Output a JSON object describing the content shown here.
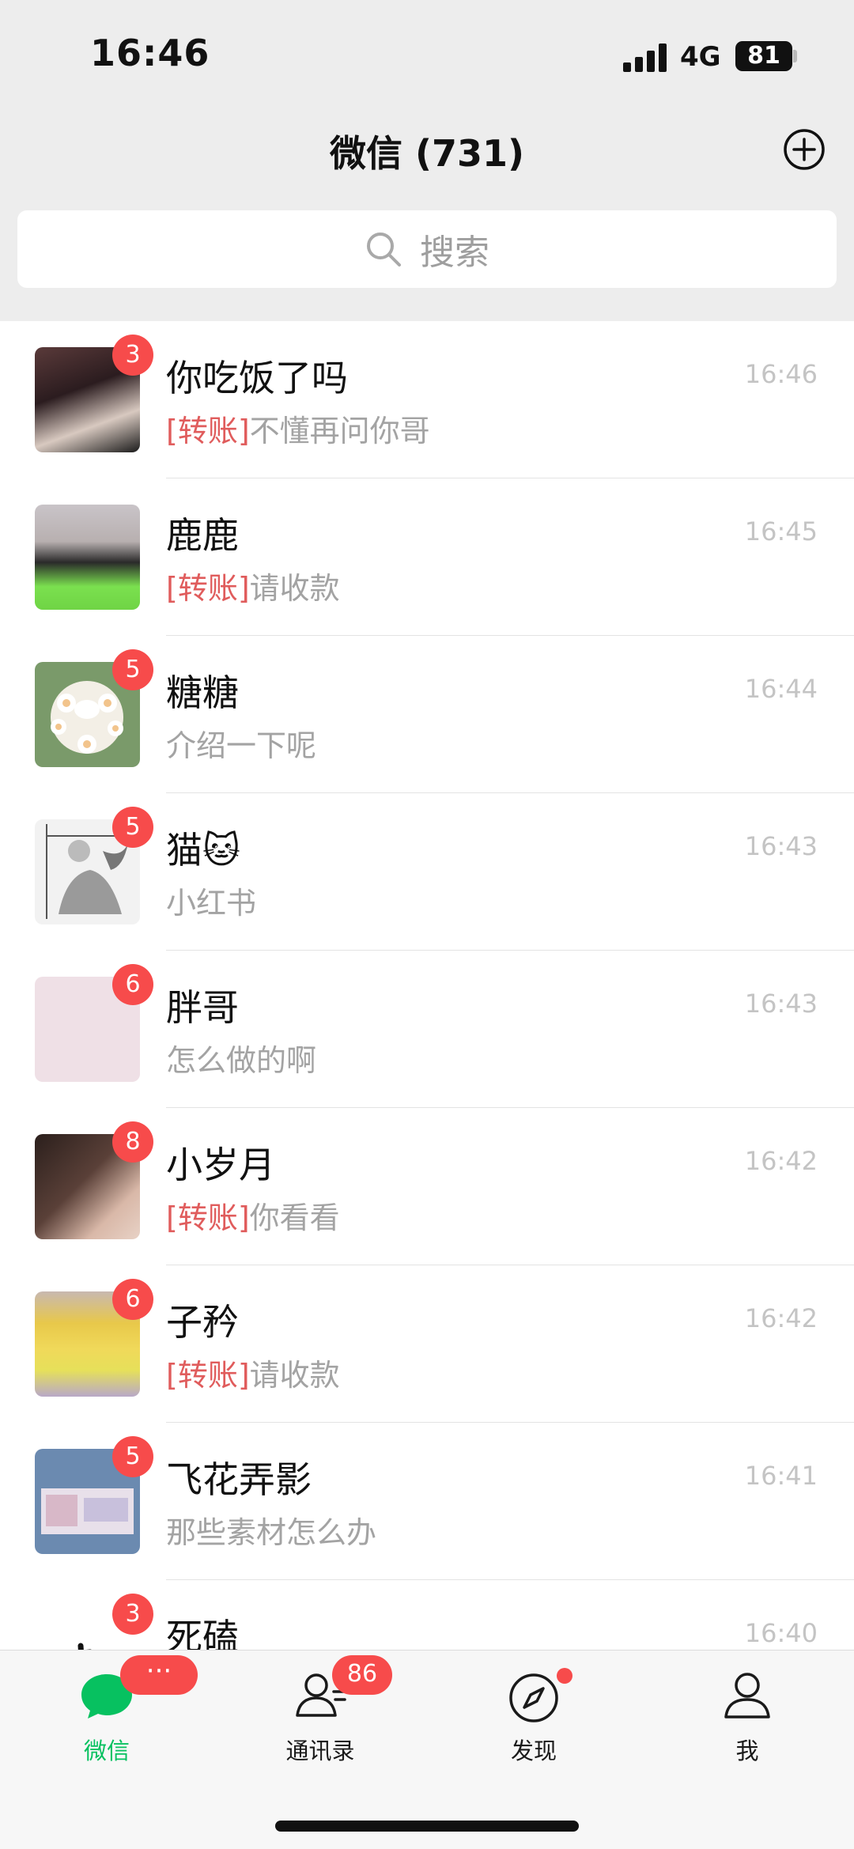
{
  "status": {
    "time": "16:46",
    "network": "4G",
    "battery": "81"
  },
  "header": {
    "title": "微信 (731)"
  },
  "search": {
    "placeholder": "搜索"
  },
  "chats": [
    {
      "name": "你吃饭了吗",
      "tag": "[转账]",
      "preview": "不懂再问你哥",
      "time": "16:46",
      "badge": "3"
    },
    {
      "name": "鹿鹿",
      "tag": "[转账]",
      "preview": "请收款",
      "time": "16:45",
      "badge": ""
    },
    {
      "name": "糖糖",
      "tag": "",
      "preview": "介绍一下呢",
      "time": "16:44",
      "badge": "5"
    },
    {
      "name": "猫🐱",
      "tag": "",
      "preview": "小红书",
      "time": "16:43",
      "badge": "5"
    },
    {
      "name": "胖哥",
      "tag": "",
      "preview": "怎么做的啊",
      "time": "16:43",
      "badge": "6"
    },
    {
      "name": "小岁月",
      "tag": "[转账]",
      "preview": "你看看",
      "time": "16:42",
      "badge": "8"
    },
    {
      "name": "子矜",
      "tag": "[转账]",
      "preview": "请收款",
      "time": "16:42",
      "badge": "6"
    },
    {
      "name": "飞花弄影",
      "tag": "",
      "preview": "那些素材怎么办",
      "time": "16:41",
      "badge": "5"
    },
    {
      "name": "死磕",
      "tag": "",
      "preview": "",
      "time": "16:40",
      "badge": "3"
    }
  ],
  "tabs": [
    {
      "label": "微信",
      "badge": "···",
      "icon": "chat-bubble-icon"
    },
    {
      "label": "通讯录",
      "badge": "86",
      "icon": "contacts-icon"
    },
    {
      "label": "发现",
      "badge": "",
      "icon": "compass-icon"
    },
    {
      "label": "我",
      "badge": "",
      "icon": "person-icon"
    }
  ],
  "colors": {
    "accent": "#07c160",
    "badge": "#f74b4b",
    "tag": "#e05c5c"
  }
}
